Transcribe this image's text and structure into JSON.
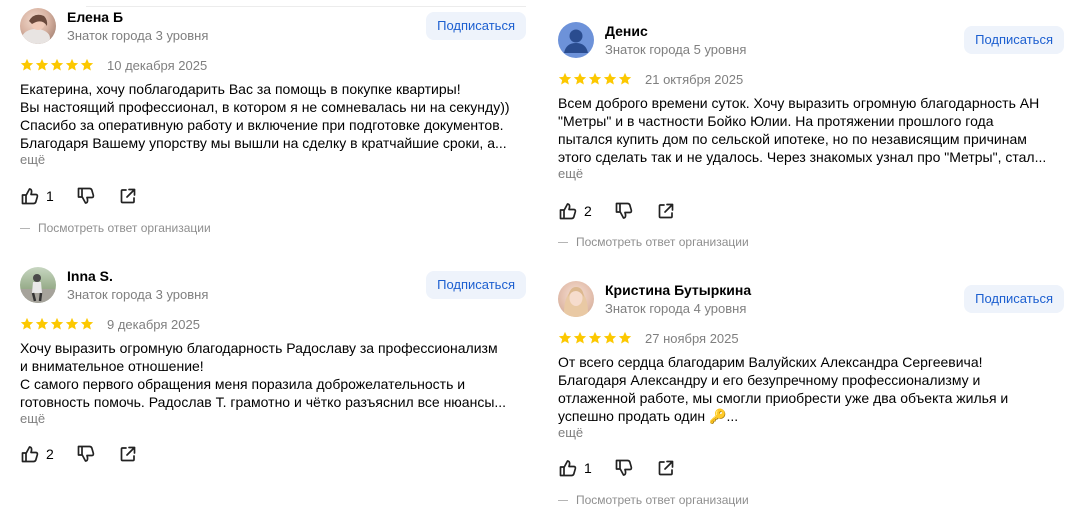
{
  "colors": {
    "star": "#fcc800",
    "link_blue": "#1c5fd0",
    "subscribe_bg": "#eef3fb",
    "muted": "#7f7f7f"
  },
  "reviews": [
    {
      "author": "Елена Б",
      "level": "Знаток города 3 уровня",
      "subscribe": "Подписаться",
      "rating": 5,
      "date": "10 декабря 2025",
      "text": [
        "Екатерина, хочу поблагодарить Вас за помощь в покупке квартиры!",
        "Вы настоящий профессионал, в котором я не сомневалась ни на секунду))",
        "Спасибо за оперативную работу и включение при подготовке документов.",
        "Благодаря Вашему упорству мы вышли на сделку в кратчайшие сроки, а..."
      ],
      "more": "ещё",
      "likes": "1",
      "answer": "Посмотреть ответ организации",
      "avatar_icon": "photo-avatar-icon"
    },
    {
      "author": "Inna S.",
      "level": "Знаток города 3 уровня",
      "subscribe": "Подписаться",
      "rating": 5,
      "date": "9 декабря 2025",
      "text": [
        "Хочу выразить огромную благодарность Радославу за профессионализм",
        "и внимательное отношение!",
        "С самого первого обращения меня поразила доброжелательность и",
        "готовность помочь. Радослав Т. грамотно и чётко разъяснил все нюансы..."
      ],
      "more": "ещё",
      "likes": "2",
      "avatar_icon": "photo-avatar-icon"
    },
    {
      "author": "Денис",
      "level": "Знаток города 5 уровня",
      "subscribe": "Подписаться",
      "rating": 5,
      "date": "21 октября 2025",
      "text": [
        "Всем доброго времени суток. Хочу выразить огромную благодарность АН",
        "\"Метры\" и в частности Бойко Юлии. На протяжении прошлого года",
        "пытался купить дом по сельской ипотеке, но по независящим причинам",
        "этого сделать так и не удалось. Через знакомых узнал про \"Метры\", стал..."
      ],
      "more": "ещё",
      "likes": "2",
      "answer": "Посмотреть ответ организации",
      "avatar_icon": "default-user-avatar-icon"
    },
    {
      "author": "Кристина Бутыркина",
      "level": "Знаток города 4 уровня",
      "subscribe": "Подписаться",
      "rating": 5,
      "date": "27 ноября 2025",
      "text": [
        "От всего сердца благодарим Валуйских Александра Сергеевича!",
        "Благодаря Александру и его безупречному профессионализму и",
        "отлаженной работе, мы смогли приобрести уже два объекта жилья и",
        "успешно продать один 🔑..."
      ],
      "more": "ещё",
      "likes": "1",
      "answer": "Посмотреть ответ организации",
      "avatar_icon": "photo-avatar-icon"
    }
  ]
}
